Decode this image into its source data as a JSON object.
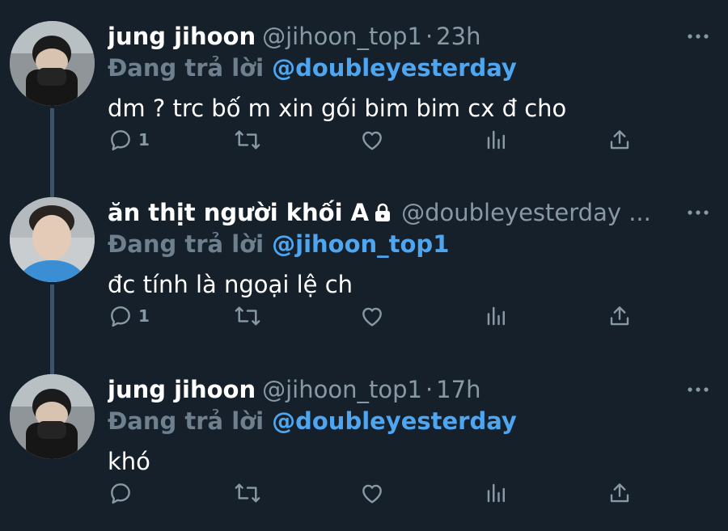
{
  "theme": {
    "background": "#15202b",
    "text_primary": "#ffffff",
    "text_secondary": "#8899a6",
    "mention_color": "#4fa6f0",
    "reply_label_color": "#6e7f8d",
    "thread_line": "#3d5466"
  },
  "tweets": [
    {
      "name": "jung jihoon",
      "locked": false,
      "handle": "@jihoon_top1",
      "separator": "·",
      "time": "23h",
      "reply_label": "Đang trả lời",
      "reply_to": "@doubleyesterday",
      "text": "dm ? trc bố m xin gói bim bim cx đ cho",
      "reply_count": "1",
      "avatar_icon": "avatar-masked-person",
      "icons": [
        "reply-icon",
        "retweet-icon",
        "like-icon",
        "stats-icon",
        "share-icon",
        "more-icon"
      ]
    },
    {
      "name": "ăn thịt người khối A",
      "locked": true,
      "handle": "@doubleyesterday ...",
      "separator": "",
      "time": "",
      "reply_label": "Đang trả lời",
      "reply_to": "@jihoon_top1",
      "text": "đc tính là ngoại lệ ch",
      "reply_count": "1",
      "avatar_icon": "avatar-person-blue-shirt",
      "icons": [
        "lock-icon",
        "reply-icon",
        "retweet-icon",
        "like-icon",
        "stats-icon",
        "share-icon",
        "more-icon"
      ]
    },
    {
      "name": "jung jihoon",
      "locked": false,
      "handle": "@jihoon_top1",
      "separator": "·",
      "time": "17h",
      "reply_label": "Đang trả lời",
      "reply_to": "@doubleyesterday",
      "text": "khó",
      "reply_count": "",
      "avatar_icon": "avatar-masked-person",
      "icons": [
        "reply-icon",
        "retweet-icon",
        "like-icon",
        "stats-icon",
        "share-icon",
        "more-icon"
      ]
    }
  ]
}
